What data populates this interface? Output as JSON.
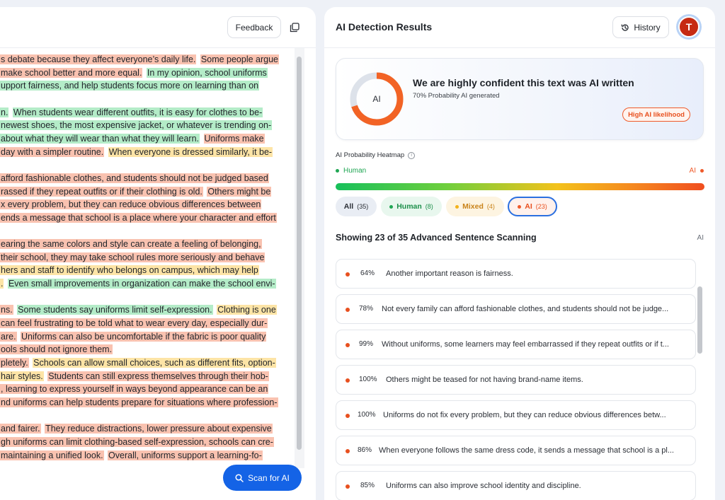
{
  "left": {
    "feedback_label": "Feedback",
    "scan_label": "Scan for AI",
    "lines": [
      [
        {
          "t": "s debate because they affect everyone’s daily life.",
          "c": "ai"
        },
        {
          "t": " ",
          "c": "none"
        },
        {
          "t": "Some people argue",
          "c": "ai"
        }
      ],
      [
        {
          "t": " make school better and more equal.",
          "c": "ai"
        },
        {
          "t": " ",
          "c": "none"
        },
        {
          "t": "In my opinion, school uniforms",
          "c": "human"
        }
      ],
      [
        {
          "t": "upport fairness, and help students focus more on learning than on",
          "c": "human"
        }
      ],
      [],
      [
        {
          "t": "n.",
          "c": "human"
        },
        {
          "t": " ",
          "c": "none"
        },
        {
          "t": "When students wear different outfits, it is easy for clothes to be-",
          "c": "human"
        }
      ],
      [
        {
          "t": "newest shoes, the most expensive jacket, or whatever is trending on-",
          "c": "human"
        }
      ],
      [
        {
          "t": "about what they will wear than what they will learn.",
          "c": "human"
        },
        {
          "t": " ",
          "c": "none"
        },
        {
          "t": "Uniforms make",
          "c": "ai"
        }
      ],
      [
        {
          "t": "day with a simpler routine.",
          "c": "ai"
        },
        {
          "t": " ",
          "c": "none"
        },
        {
          "t": "When everyone is dressed similarly, it be-",
          "c": "mixed"
        }
      ],
      [],
      [
        {
          "t": "afford fashionable clothes, and students should not be judged based",
          "c": "ai"
        }
      ],
      [
        {
          "t": "rassed if they repeat outfits or if their clothing is old.",
          "c": "ai"
        },
        {
          "t": " ",
          "c": "none"
        },
        {
          "t": "Others might be",
          "c": "ai"
        }
      ],
      [
        {
          "t": "x every problem, but they can reduce obvious differences between",
          "c": "ai"
        }
      ],
      [
        {
          "t": "ends a message that school is a place where your character and effort",
          "c": "ai"
        }
      ],
      [],
      [
        {
          "t": "earing the same colors and style can create a feeling of belonging,",
          "c": "ai"
        }
      ],
      [
        {
          "t": "their school, they may take school rules more seriously and behave",
          "c": "ai"
        }
      ],
      [
        {
          "t": "hers and staff to identify who belongs on campus, which may help",
          "c": "mixed"
        }
      ],
      [
        {
          "t": ".",
          "c": "mixed"
        },
        {
          "t": " ",
          "c": "none"
        },
        {
          "t": "Even small improvements in organization can make the school envi-",
          "c": "human"
        }
      ],
      [],
      [
        {
          "t": "ns.",
          "c": "ai"
        },
        {
          "t": " ",
          "c": "none"
        },
        {
          "t": "Some students say uniforms limit self-expression.",
          "c": "human"
        },
        {
          "t": " ",
          "c": "none"
        },
        {
          "t": "Clothing is one",
          "c": "mixed"
        }
      ],
      [
        {
          "t": " can feel frustrating to be told what to wear every day, especially dur-",
          "c": "ai"
        }
      ],
      [
        {
          "t": "are.",
          "c": "ai"
        },
        {
          "t": " ",
          "c": "none"
        },
        {
          "t": "Uniforms can also be uncomfortable if the fabric is poor quality",
          "c": "ai"
        }
      ],
      [
        {
          "t": "ools should not ignore them.",
          "c": "ai"
        }
      ],
      [
        {
          "t": "pletely.",
          "c": "ai"
        },
        {
          "t": " ",
          "c": "none"
        },
        {
          "t": "Schools can allow small choices, such as different fits, option-",
          "c": "mixed"
        }
      ],
      [
        {
          "t": "hair styles.",
          "c": "mixed"
        },
        {
          "t": " ",
          "c": "none"
        },
        {
          "t": "Students can still express themselves through their hob-",
          "c": "ai"
        }
      ],
      [
        {
          "t": ", learning to express yourself in ways beyond appearance can be an",
          "c": "ai"
        }
      ],
      [
        {
          "t": "nd uniforms can help students prepare for situations where profession-",
          "c": "ai"
        }
      ],
      [],
      [
        {
          "t": "and fairer.",
          "c": "ai"
        },
        {
          "t": " ",
          "c": "none"
        },
        {
          "t": "They reduce distractions, lower pressure about expensive",
          "c": "ai"
        }
      ],
      [
        {
          "t": "gh uniforms can limit clothing-based self-expression, schools can cre-",
          "c": "ai"
        }
      ],
      [
        {
          "t": "maintaining a unified look.",
          "c": "ai"
        },
        {
          "t": " ",
          "c": "none"
        },
        {
          "t": "Overall, uniforms support a learning-fo-",
          "c": "ai"
        }
      ]
    ]
  },
  "right": {
    "title": "AI Detection Results",
    "history_label": "History",
    "avatar_initial": "T",
    "summary": {
      "donut_label": "AI",
      "ai_probability_percent": 70,
      "headline": "We are highly confident this text was AI written",
      "subtext": "70% Probability AI generated",
      "badge": "High AI likelihood"
    },
    "heatmap": {
      "label": "AI Probability Heatmap",
      "human_label": "Human",
      "ai_label": "AI"
    },
    "filters": [
      {
        "label": "All",
        "count": "(35)"
      },
      {
        "label": "Human",
        "count": "(8)"
      },
      {
        "label": "Mixed",
        "count": "(4)"
      },
      {
        "label": "AI",
        "count": "(23)"
      }
    ],
    "showing_title": "Showing 23 of 35 Advanced Sentence Scanning",
    "showing_ai": "AI",
    "sentences": [
      {
        "pct": "64%",
        "text": "Another important reason is fairness."
      },
      {
        "pct": "78%",
        "text": "Not every family can afford fashionable clothes, and students should not be judge..."
      },
      {
        "pct": "99%",
        "text": "Without uniforms, some learners may feel embarrassed if they repeat outfits or if t..."
      },
      {
        "pct": "100%",
        "text": "Others might be teased for not having brand-name items."
      },
      {
        "pct": "100%",
        "text": "Uniforms do not fix every problem, but they can reduce obvious differences betw..."
      },
      {
        "pct": "86%",
        "text": "When everyone follows the same dress code, it sends a message that school is a pl..."
      },
      {
        "pct": "85%",
        "text": "Uniforms can also improve school identity and discipline."
      }
    ]
  },
  "colors": {
    "accent_blue": "#1463e6",
    "ai_orange": "#ef5a2a",
    "human_green": "#1fa653",
    "mixed_yellow": "#f3b21b"
  }
}
